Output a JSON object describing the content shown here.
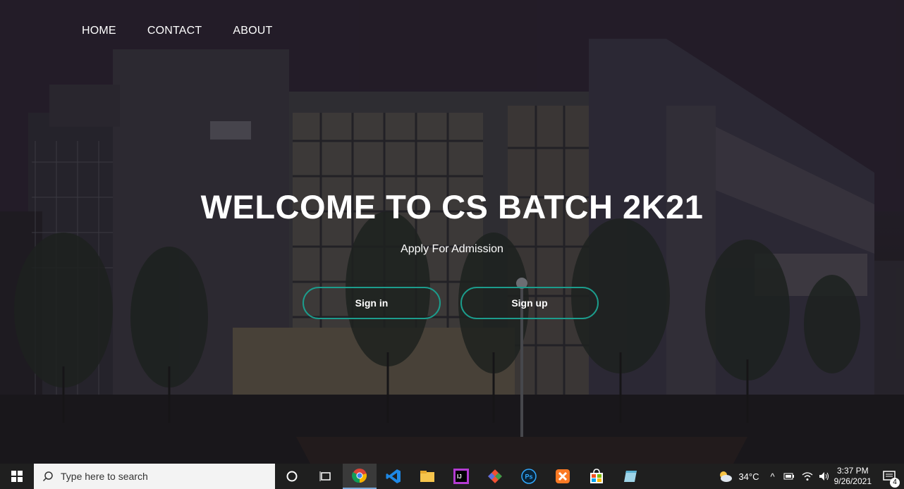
{
  "nav": {
    "items": [
      "HOME",
      "CONTACT",
      "ABOUT"
    ]
  },
  "hero": {
    "title": "WELCOME TO CS BATCH 2K21",
    "subtitle": "Apply For Admission",
    "signin_label": "Sign in",
    "signup_label": "Sign up"
  },
  "taskbar": {
    "search_placeholder": "Type here to search",
    "apps": [
      "task-view",
      "chrome",
      "vscode",
      "file-explorer",
      "intellij",
      "git",
      "photoshop",
      "xampp",
      "store",
      "notepad"
    ],
    "weather": "34°C",
    "time": "3:37 PM",
    "date": "9/26/2021",
    "notifications": "4"
  },
  "colors": {
    "accent": "#1c9c8c",
    "taskbar": "#1f1f1f"
  }
}
